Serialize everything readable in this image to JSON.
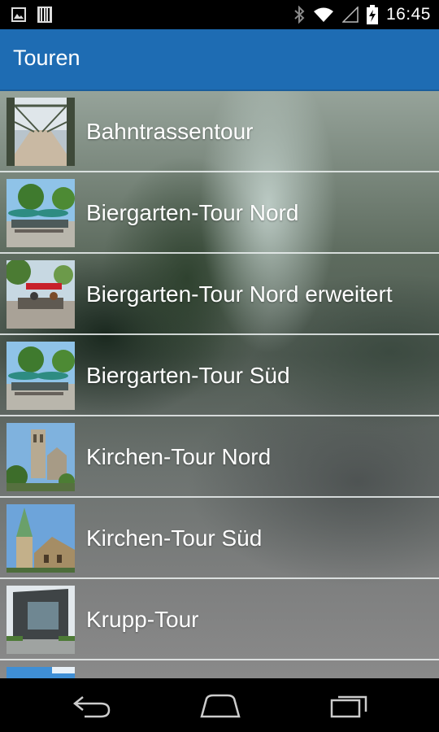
{
  "status_bar": {
    "time": "16:45",
    "icons_left": [
      "image-notification-icon",
      "barcode-notification-icon"
    ],
    "icons_right": [
      "bluetooth-icon",
      "wifi-icon",
      "signal-icon",
      "battery-charging-icon"
    ]
  },
  "app_bar": {
    "title": "Touren",
    "color": "#1e6cb3"
  },
  "tours": [
    {
      "label": "Bahntrassentour",
      "thumb": "railway-bridge-photo"
    },
    {
      "label": "Biergarten-Tour Nord",
      "thumb": "beer-garden-photo"
    },
    {
      "label": "Biergarten-Tour Nord erweitert",
      "thumb": "beer-garden-terrace-photo"
    },
    {
      "label": "Biergarten-Tour Süd",
      "thumb": "beer-garden-photo"
    },
    {
      "label": "Kirchen-Tour Nord",
      "thumb": "church-tower-photo"
    },
    {
      "label": "Kirchen-Tour Süd",
      "thumb": "church-spire-photo"
    },
    {
      "label": "Krupp-Tour",
      "thumb": "krupp-building-photo"
    },
    {
      "label": "",
      "thumb": "sky-photo"
    }
  ],
  "nav_bar": {
    "buttons": [
      "back-icon",
      "home-icon",
      "recents-icon"
    ]
  }
}
